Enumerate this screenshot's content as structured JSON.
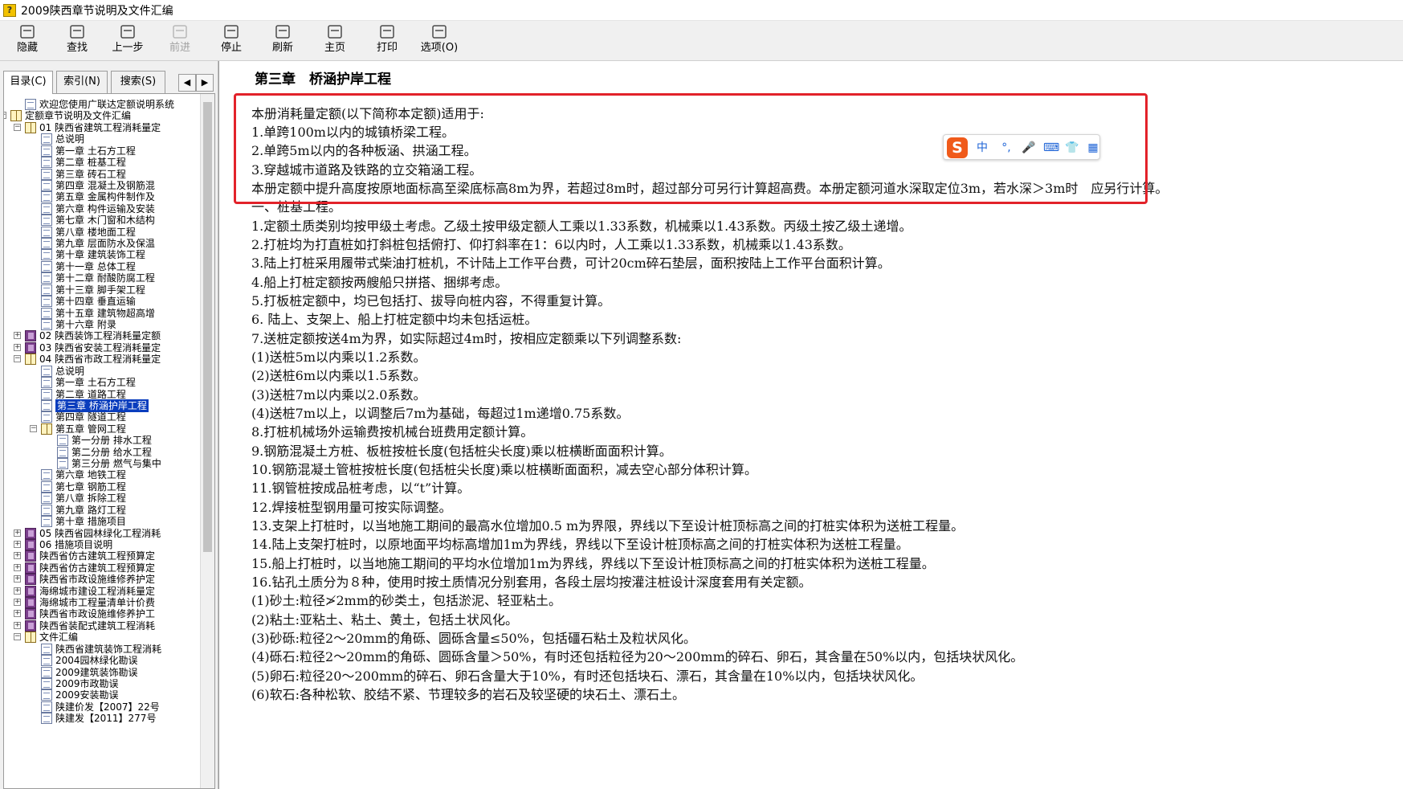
{
  "window": {
    "title": "2009陕西章节说明及文件汇编"
  },
  "toolbar": [
    {
      "label": "隐藏",
      "icon": "hide-icon",
      "enabled": true
    },
    {
      "label": "查找",
      "icon": "find-icon",
      "enabled": true
    },
    {
      "label": "上一步",
      "icon": "back-arrow-icon",
      "enabled": true
    },
    {
      "label": "前进",
      "icon": "forward-arrow-icon",
      "enabled": false
    },
    {
      "label": "停止",
      "icon": "stop-icon",
      "enabled": true
    },
    {
      "label": "刷新",
      "icon": "refresh-icon",
      "enabled": true
    },
    {
      "label": "主页",
      "icon": "home-icon",
      "enabled": true
    },
    {
      "label": "打印",
      "icon": "print-icon",
      "enabled": true
    },
    {
      "label": "选项(O)",
      "icon": "options-icon",
      "enabled": true
    }
  ],
  "nav_tabs": [
    {
      "label": "目录(C)",
      "active": true
    },
    {
      "label": "索引(N)",
      "active": false
    },
    {
      "label": "搜索(S)",
      "active": false
    }
  ],
  "nav_arrows": {
    "left": "◀",
    "right": "▶"
  },
  "tree": [
    {
      "text": "欢迎您使用广联达定额说明系统",
      "level": 1,
      "icon": "page",
      "toggle": ""
    },
    {
      "text": "定额章节说明及文件汇编",
      "level": 0,
      "icon": "openbook",
      "toggle": "−"
    },
    {
      "text": "01 陕西省建筑工程消耗量定",
      "level": 1,
      "icon": "openbook",
      "toggle": "−"
    },
    {
      "text": "总说明",
      "level": 2,
      "icon": "page",
      "toggle": ""
    },
    {
      "text": "第一章 土石方工程",
      "level": 2,
      "icon": "page",
      "toggle": ""
    },
    {
      "text": "第二章 桩基工程",
      "level": 2,
      "icon": "page",
      "toggle": ""
    },
    {
      "text": "第三章 砖石工程",
      "level": 2,
      "icon": "page",
      "toggle": ""
    },
    {
      "text": "第四章 混凝土及钢筋混",
      "level": 2,
      "icon": "page",
      "toggle": ""
    },
    {
      "text": "第五章 金属构件制作及",
      "level": 2,
      "icon": "page",
      "toggle": ""
    },
    {
      "text": "第六章 构件运输及安装",
      "level": 2,
      "icon": "page",
      "toggle": ""
    },
    {
      "text": "第七章 木门窗和木结构",
      "level": 2,
      "icon": "page",
      "toggle": ""
    },
    {
      "text": "第八章 楼地面工程",
      "level": 2,
      "icon": "page",
      "toggle": ""
    },
    {
      "text": "第九章 层面防水及保温",
      "level": 2,
      "icon": "page",
      "toggle": ""
    },
    {
      "text": "第十章 建筑装饰工程",
      "level": 2,
      "icon": "page",
      "toggle": ""
    },
    {
      "text": "第十一章 总体工程",
      "level": 2,
      "icon": "page",
      "toggle": ""
    },
    {
      "text": "第十二章 耐酸防腐工程",
      "level": 2,
      "icon": "page",
      "toggle": ""
    },
    {
      "text": "第十三章 脚手架工程",
      "level": 2,
      "icon": "page",
      "toggle": ""
    },
    {
      "text": "第十四章 垂直运输",
      "level": 2,
      "icon": "page",
      "toggle": ""
    },
    {
      "text": "第十五章 建筑物超高增",
      "level": 2,
      "icon": "page",
      "toggle": ""
    },
    {
      "text": "第十六章 附录",
      "level": 2,
      "icon": "page",
      "toggle": ""
    },
    {
      "text": "02 陕西装饰工程消耗量定额",
      "level": 1,
      "icon": "book",
      "toggle": "+"
    },
    {
      "text": "03 陕西省安装工程消耗量定",
      "level": 1,
      "icon": "book",
      "toggle": "+"
    },
    {
      "text": "04 陕西省市政工程消耗量定",
      "level": 1,
      "icon": "openbook",
      "toggle": "−"
    },
    {
      "text": "总说明",
      "level": 2,
      "icon": "page",
      "toggle": ""
    },
    {
      "text": "第一章 土石方工程",
      "level": 2,
      "icon": "page",
      "toggle": ""
    },
    {
      "text": "第二章 道路工程",
      "level": 2,
      "icon": "page",
      "toggle": ""
    },
    {
      "text": "第三章 桥涵护岸工程",
      "level": 2,
      "icon": "page",
      "toggle": "",
      "selected": true
    },
    {
      "text": "第四章 隧道工程",
      "level": 2,
      "icon": "page",
      "toggle": ""
    },
    {
      "text": "第五章 管网工程",
      "level": 2,
      "icon": "openbook",
      "toggle": "−"
    },
    {
      "text": "第一分册 排水工程",
      "level": 3,
      "icon": "page",
      "toggle": ""
    },
    {
      "text": "第二分册 给水工程",
      "level": 3,
      "icon": "page",
      "toggle": ""
    },
    {
      "text": "第三分册 燃气与集中",
      "level": 3,
      "icon": "page",
      "toggle": ""
    },
    {
      "text": "第六章 地铁工程",
      "level": 2,
      "icon": "page",
      "toggle": ""
    },
    {
      "text": "第七章 钢筋工程",
      "level": 2,
      "icon": "page",
      "toggle": ""
    },
    {
      "text": "第八章 拆除工程",
      "level": 2,
      "icon": "page",
      "toggle": ""
    },
    {
      "text": "第九章 路灯工程",
      "level": 2,
      "icon": "page",
      "toggle": ""
    },
    {
      "text": "第十章 措施项目",
      "level": 2,
      "icon": "page",
      "toggle": ""
    },
    {
      "text": "05 陕西省园林绿化工程消耗",
      "level": 1,
      "icon": "book",
      "toggle": "+"
    },
    {
      "text": "06 措施项目说明",
      "level": 1,
      "icon": "book",
      "toggle": "+"
    },
    {
      "text": "陕西省仿古建筑工程预算定",
      "level": 1,
      "icon": "book",
      "toggle": "+"
    },
    {
      "text": "陕西省仿古建筑工程预算定",
      "level": 1,
      "icon": "book",
      "toggle": "+"
    },
    {
      "text": "陕西省市政设施维修养护定",
      "level": 1,
      "icon": "book",
      "toggle": "+"
    },
    {
      "text": "海绵城市建设工程消耗量定",
      "level": 1,
      "icon": "book",
      "toggle": "+"
    },
    {
      "text": "海绵城市工程量清单计价费",
      "level": 1,
      "icon": "book",
      "toggle": "+"
    },
    {
      "text": "陕西省市政设施维修养护工",
      "level": 1,
      "icon": "book",
      "toggle": "+"
    },
    {
      "text": "陕西省装配式建筑工程消耗",
      "level": 1,
      "icon": "book",
      "toggle": "+"
    },
    {
      "text": "文件汇编",
      "level": 1,
      "icon": "openbook",
      "toggle": "−"
    },
    {
      "text": "陕西省建筑装饰工程消耗",
      "level": 2,
      "icon": "page",
      "toggle": ""
    },
    {
      "text": "2004园林绿化勘误",
      "level": 2,
      "icon": "page",
      "toggle": ""
    },
    {
      "text": "2009建筑装饰勘误",
      "level": 2,
      "icon": "page",
      "toggle": ""
    },
    {
      "text": "2009市政勘误",
      "level": 2,
      "icon": "page",
      "toggle": ""
    },
    {
      "text": "2009安装勘误",
      "level": 2,
      "icon": "page",
      "toggle": ""
    },
    {
      "text": "陕建价发【2007】22号",
      "level": 2,
      "icon": "page",
      "toggle": ""
    },
    {
      "text": "陕建发【2011】277号",
      "level": 2,
      "icon": "page",
      "toggle": ""
    }
  ],
  "content": {
    "heading": "第三章　桥涵护岸工程",
    "paragraphs": [
      "本册消耗量定额(以下简称本定额)适用于:",
      "1.单跨100m以内的城镇桥梁工程。",
      "2.单跨5m以内的各种板涵、拱涵工程。",
      "3.穿越城市道路及铁路的立交箱涵工程。",
      "本册定额中提升高度按原地面标高至梁底标高8m为界，若超过8m时，超过部分可另行计算超高费。本册定额河道水深取定位3m，若水深＞3m时　应另行计算。",
      "一、桩基工程。",
      "1.定额土质类别均按甲级土考虑。乙级土按甲级定额人工乘以1.33系数，机械乘以1.43系数。丙级土按乙级土递增。",
      "2.打桩均为打直桩如打斜桩包括俯打、仰打斜率在1：6以内时，人工乘以1.33系数，机械乘以1.43系数。",
      "3.陆上打桩采用履带式柴油打桩机，不计陆上工作平台费，可计20cm碎石垫层，面积按陆上工作平台面积计算。",
      "4.船上打桩定额按两艘船只拼搭、捆绑考虑。",
      "5.打板桩定额中，均已包括打、拔导向桩内容，不得重复计算。",
      "6. 陆上、支架上、船上打桩定额中均未包括运桩。",
      "7.送桩定额按送4m为界，如实际超过4m时，按相应定额乘以下列调整系数:",
      "(1)送桩5m以内乘以1.2系数。",
      "(2)送桩6m以内乘以1.5系数。",
      "(3)送桩7m以内乘以2.0系数。",
      "(4)送桩7m以上，以调整后7m为基础，每超过1m递增0.75系数。",
      "8.打桩机械场外运输费按机械台班费用定额计算。",
      "9.钢筋混凝土方桩、板桩按桩长度(包括桩尖长度)乘以桩横断面面积计算。",
      "10.钢筋混凝土管桩按桩长度(包括桩尖长度)乘以桩横断面面积，减去空心部分体积计算。",
      "11.钢管桩按成品桩考虑，以“t”计算。",
      "12.焊接桩型钢用量可按实际调整。",
      "13.支架上打桩时，以当地施工期间的最高水位增加0.5 m为界限，界线以下至设计桩顶标高之间的打桩实体积为送桩工程量。",
      "14.陆上支架打桩时，以原地面平均标高增加1m为界线，界线以下至设计桩顶标高之间的打桩实体积为送桩工程量。",
      "15.船上打桩时，以当地施工期间的平均水位增加1m为界线，界线以下至设计桩顶标高之间的打桩实体积为送桩工程量。",
      "16.钻孔土质分为８种，使用时按土质情况分别套用，各段土层均按灌注桩设计深度套用有关定额。",
      "(1)砂土:粒径≯2mm的砂类土，包括淤泥、轻亚粘土。",
      "(2)粘土:亚粘土、粘土、黄土，包括土状风化。",
      "(3)砂砾:粒径2～20mm的角砾、圆砾含量≤50%，包括礓石粘土及粒状风化。",
      "(4)砾石:粒径2～20mm的角砾、圆砾含量＞50%，有时还包括粒径为20～200mm的碎石、卵石，其含量在50%以内，包括块状风化。",
      "(5)卵石:粒径20～200mm的碎石、卵石含量大于10%，有时还包括块石、漂石，其含量在10%以内，包括块状风化。",
      "(6)软石:各种松软、胶结不紧、节理较多的岩石及较坚硬的块石土、漂石土。"
    ]
  },
  "ime_toolbar": {
    "logo": "S",
    "items": [
      {
        "text": "中",
        "icon": "chinese-mode-icon"
      },
      {
        "text": "°,",
        "icon": "punctuation-icon"
      },
      {
        "text": "🎤",
        "icon": "microphone-icon"
      },
      {
        "text": "⌨",
        "icon": "keyboard-icon"
      },
      {
        "text": "👕",
        "icon": "skin-icon"
      },
      {
        "text": "▦",
        "icon": "toolbox-icon"
      }
    ]
  },
  "colors": {
    "highlight_box": "#e2222a",
    "selection": "#0a3dbd",
    "ime_accent": "#f05a1a"
  }
}
